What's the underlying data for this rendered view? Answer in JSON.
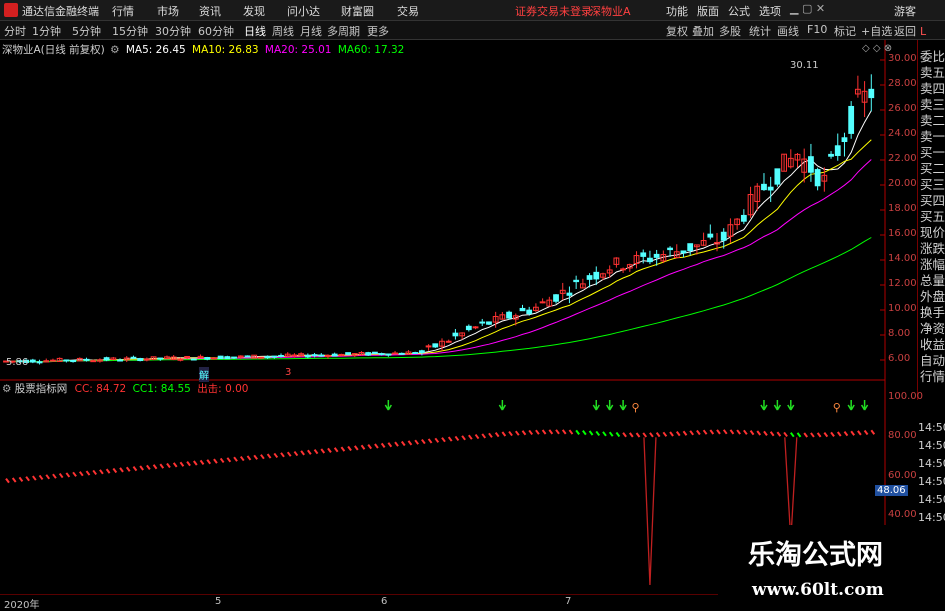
{
  "app": {
    "title": "通达信金融终端"
  },
  "menu": [
    "行情",
    "市场",
    "资讯",
    "发现",
    "问小达",
    "财富圈",
    "交易"
  ],
  "notice": {
    "text": "证券交易未登录",
    "stock": "深物业A"
  },
  "right_menu": [
    "功能",
    "版面",
    "公式",
    "选项"
  ],
  "guest": "游客",
  "tabs": [
    "分时",
    "1分钟",
    "5分钟",
    "15分钟",
    "30分钟",
    "60分钟",
    "日线",
    "周线",
    "月线",
    "多周期",
    "更多"
  ],
  "active_tab": "日线",
  "tools": [
    "复权",
    "叠加",
    "多股",
    "统计",
    "画线",
    "F10",
    "标记",
    "+自选",
    "返回"
  ],
  "chart_head": {
    "name": "深物业A(日线 前复权)",
    "ma5": "MA5: 26.45",
    "ma10": "MA10: 26.83",
    "ma20": "MA20: 25.01",
    "ma60": "MA60: 17.32",
    "high_label": "30.11",
    "low_label": "5.86"
  },
  "price_axis": [
    "30.00",
    "28.00",
    "26.00",
    "24.00",
    "22.00",
    "20.00",
    "18.00",
    "16.00",
    "14.00",
    "12.00",
    "10.00",
    "8.00",
    "6.00"
  ],
  "side_panel": [
    "委比",
    "卖五",
    "卖四",
    "卖三",
    "卖二",
    "卖一",
    "买一",
    "买二",
    "买三",
    "买四",
    "买五",
    "现价",
    "涨跌",
    "涨幅",
    "总量",
    "外盘",
    "换手",
    "净资",
    "收益",
    "自动",
    "行情"
  ],
  "time_labels": [
    "14:50",
    "14:50",
    "14:50",
    "14:50",
    "14:50",
    "14:50",
    "14:50"
  ],
  "indicator_head": {
    "name": "股票指标网",
    "cc": "CC: 84.72",
    "cc1": "CC1: 84.55",
    "signal": "出击: 0.00"
  },
  "ind_axis": [
    "100.00",
    "80.00",
    "60.00",
    "40.00"
  ],
  "ind_current": "48.06",
  "dates": [
    "2020年",
    "5",
    "6",
    "7"
  ],
  "markers": {
    "one": "解",
    "two": "3"
  },
  "watermark": {
    "title": "乐淘公式网",
    "url": "www.60lt.com"
  },
  "colors": {
    "up": "#ff3232",
    "down": "#54ffff",
    "ma5": "#ffffff",
    "ma10": "#ffff00",
    "ma20": "#ff00ff",
    "ma60": "#00ff00",
    "axis_line": "#b00000"
  }
}
